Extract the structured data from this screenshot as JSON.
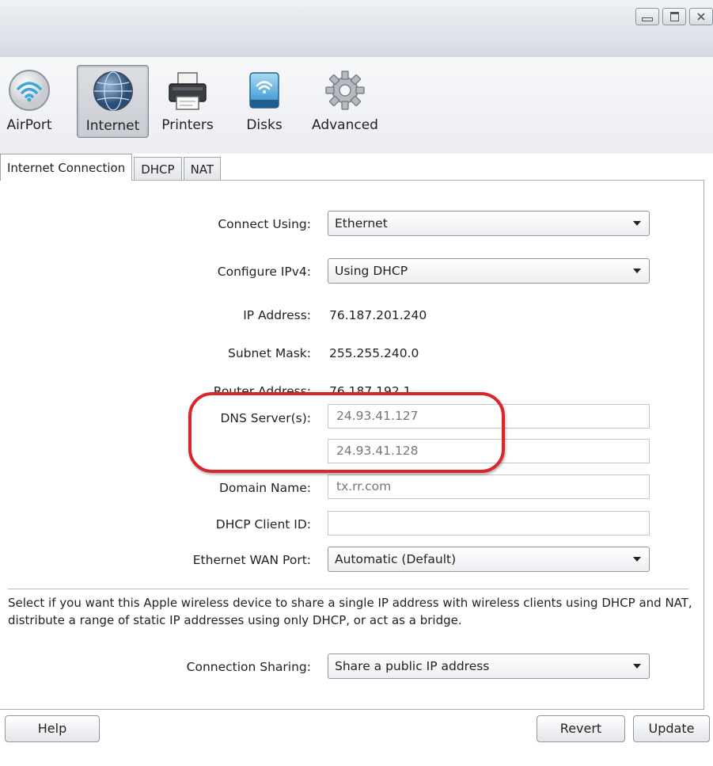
{
  "window": {
    "controls": [
      "minimize",
      "maximize",
      "close"
    ]
  },
  "toolbar": {
    "items": [
      {
        "label": "AirPort",
        "icon": "airport-wifi-icon"
      },
      {
        "label": "Internet",
        "icon": "globe-icon",
        "selected": true
      },
      {
        "label": "Printers",
        "icon": "printer-icon"
      },
      {
        "label": "Disks",
        "icon": "disk-icon"
      },
      {
        "label": "Advanced",
        "icon": "gear-icon"
      }
    ]
  },
  "tabs": [
    {
      "label": "Internet Connection",
      "active": true
    },
    {
      "label": "DHCP"
    },
    {
      "label": "NAT"
    }
  ],
  "form": {
    "connect_using_label": "Connect Using:",
    "connect_using_value": "Ethernet",
    "configure_ipv4_label": "Configure IPv4:",
    "configure_ipv4_value": "Using DHCP",
    "ip_address_label": "IP Address:",
    "ip_address_value": "76.187.201.240",
    "subnet_mask_label": "Subnet Mask:",
    "subnet_mask_value": "255.255.240.0",
    "router_address_label": "Router Address:",
    "router_address_value": "76.187.192.1",
    "dns_label": "DNS Server(s):",
    "dns_primary": "24.93.41.127",
    "dns_secondary": "24.93.41.128",
    "domain_name_label": "Domain Name:",
    "domain_name_value": "tx.rr.com",
    "dhcp_client_id_label": "DHCP Client ID:",
    "dhcp_client_id_value": "",
    "ethernet_wan_port_label": "Ethernet WAN Port:",
    "ethernet_wan_port_value": "Automatic (Default)"
  },
  "sharing": {
    "description": "Select if you want this Apple wireless device to share a single IP address with wireless clients using DHCP and NAT, distribute a range of static IP addresses using only DHCP, or act as a bridge.",
    "connection_sharing_label": "Connection Sharing:",
    "connection_sharing_value": "Share a public IP address"
  },
  "buttons": {
    "help": "Help",
    "revert": "Revert",
    "update": "Update"
  },
  "colors": {
    "highlight_circle": "#d8262a"
  }
}
